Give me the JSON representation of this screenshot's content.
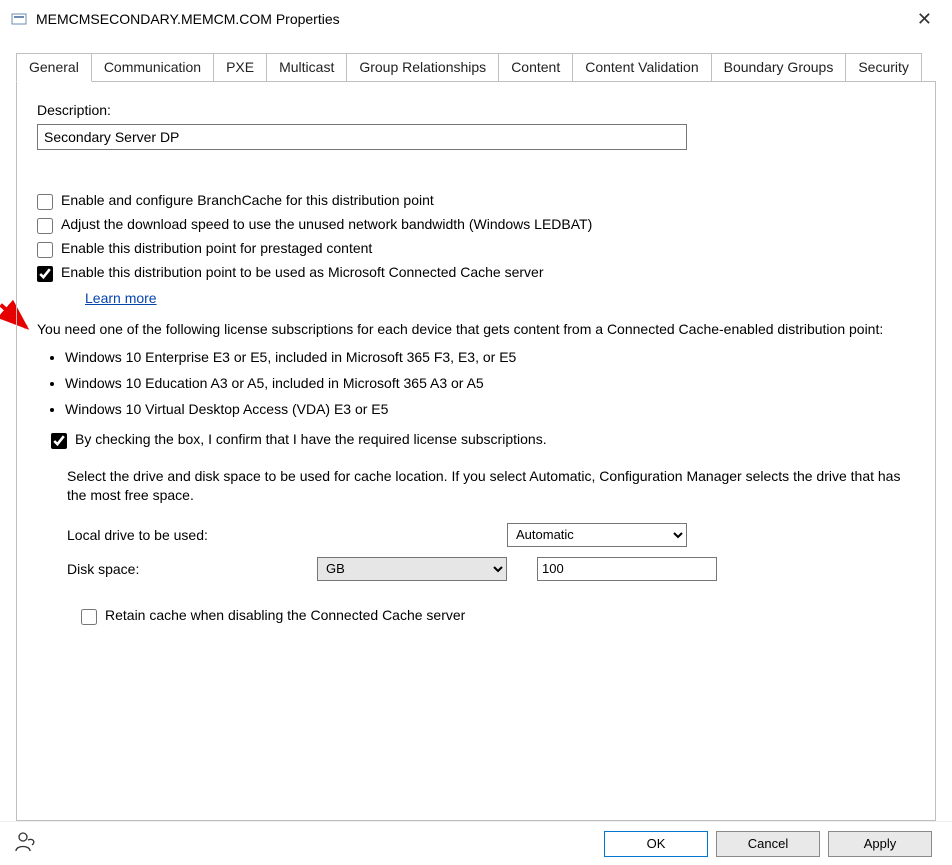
{
  "window": {
    "title": "MEMCMSECONDARY.MEMCM.COM Properties"
  },
  "tabs": {
    "items": [
      "General",
      "Communication",
      "PXE",
      "Multicast",
      "Group Relationships",
      "Content",
      "Content Validation",
      "Boundary Groups",
      "Security"
    ],
    "active_index": 0
  },
  "general": {
    "description_label": "Description:",
    "description_value": "Secondary Server DP",
    "checkboxes": {
      "branchcache": {
        "label": "Enable and configure BranchCache for this distribution point",
        "checked": false
      },
      "ledbat": {
        "label": "Adjust the download speed to use the unused network bandwidth (Windows LEDBAT)",
        "checked": false
      },
      "prestaged": {
        "label": "Enable this distribution point for prestaged content",
        "checked": false
      },
      "connected_cache": {
        "label": "Enable this distribution point to be used as Microsoft Connected Cache server",
        "checked": true
      },
      "confirm_license": {
        "label": "By checking the box, I confirm that I have the required license subscriptions.",
        "checked": true
      },
      "retain_cache": {
        "label": "Retain cache when disabling the Connected Cache server",
        "checked": false
      }
    },
    "learn_more": "Learn more",
    "license_intro": "You need one of the following license subscriptions for each device that gets content from a Connected Cache-enabled distribution point:",
    "license_bullets": [
      "Windows 10 Enterprise E3 or E5, included in Microsoft 365 F3, E3, or E5",
      "Windows 10 Education A3 or A5, included in Microsoft 365 A3 or A5",
      "Windows 10 Virtual Desktop Access (VDA) E3 or E5"
    ],
    "drive_intro": "Select the drive and disk space to be used for cache location. If you select Automatic, Configuration Manager selects the drive that has the most free space.",
    "drive_label": "Local drive to be used:",
    "drive_value": "Automatic",
    "disk_label": "Disk space:",
    "disk_unit": "GB",
    "disk_value": "100"
  },
  "footer": {
    "ok": "OK",
    "cancel": "Cancel",
    "apply": "Apply"
  }
}
